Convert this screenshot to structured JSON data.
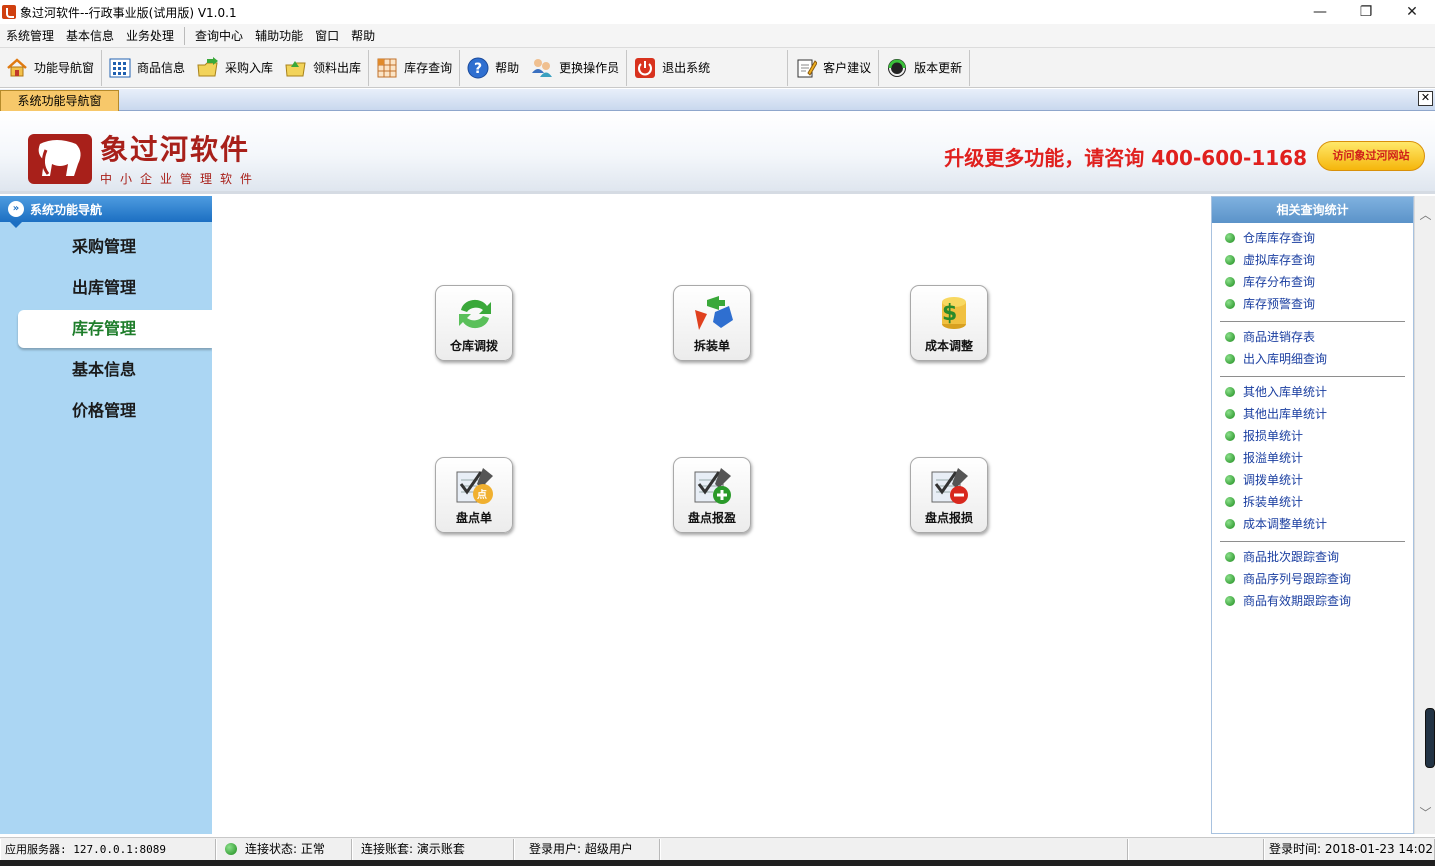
{
  "window": {
    "title": "象过河软件--行政事业版(试用版) V1.0.1",
    "minimize": "—",
    "restore": "❐",
    "close": "✕"
  },
  "menu": [
    "系统管理",
    "基本信息",
    "业务处理",
    "查询中心",
    "辅助功能",
    "窗口",
    "帮助"
  ],
  "toolbar": {
    "nav_window": "功能导航窗",
    "product_info": "商品信息",
    "purchase_in": "采购入库",
    "material_out": "领料出库",
    "stock_query": "库存查询",
    "help": "帮助",
    "switch_operator": "更换操作员",
    "exit_system": "退出系统",
    "customer_feedback": "客户建议",
    "version_update": "版本更新"
  },
  "tab": {
    "label": "系统功能导航窗",
    "close": "✕"
  },
  "banner": {
    "logo_main": "象过河软件",
    "logo_sub": "中小企业管理软件",
    "promo": "升级更多功能，请咨询 400-600-1168",
    "visit_button": "访问象过河网站"
  },
  "leftnav": {
    "header": "系统功能导航",
    "header_icon": "»",
    "items": [
      "采购管理",
      "出库管理",
      "库存管理",
      "基本信息",
      "价格管理"
    ],
    "active_index": 2
  },
  "main": {
    "buttons": [
      "仓库调拨",
      "拆装单",
      "成本调整",
      "盘点单",
      "盘点报盈",
      "盘点报损"
    ],
    "check_badge": "点"
  },
  "rightpanel": {
    "header": "相关查询统计",
    "groups": [
      [
        "仓库库存查询",
        "虚拟库存查询",
        "库存分布查询",
        "库存预警查询"
      ],
      [
        "商品进销存表",
        "出入库明细查询"
      ],
      [
        "其他入库单统计",
        "其他出库单统计",
        "报损单统计",
        "报溢单统计",
        "调拨单统计",
        "拆装单统计",
        "成本调整单统计"
      ],
      [
        "商品批次跟踪查询",
        "商品序列号跟踪查询",
        "商品有效期跟踪查询"
      ]
    ]
  },
  "statusbar": {
    "server": "应用服务器: 127.0.0.1:8089",
    "connection": "连接状态: 正常",
    "account": "连接账套: 演示账套",
    "user": "登录用户: 超级用户",
    "login_time": "登录时间: 2018-01-23 14:02"
  },
  "colors": {
    "nav_bg": "#abd6f3",
    "active_nav_text": "#1e7d2a",
    "promo_red": "#e0201e",
    "link_blue": "#1a3ea0",
    "logo_red": "#a8201a"
  }
}
